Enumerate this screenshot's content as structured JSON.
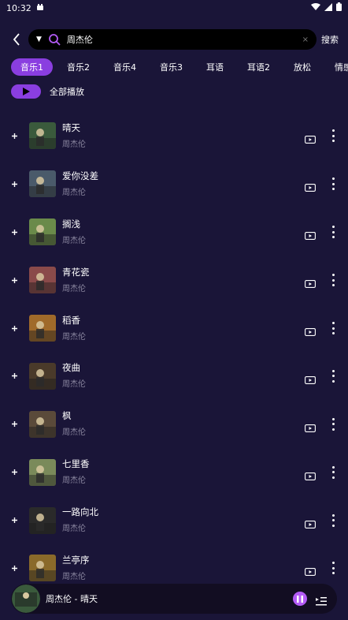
{
  "status_bar": {
    "time": "10:32"
  },
  "header": {
    "search_value": "周杰伦",
    "search_button": "搜索",
    "dropdown_glyph": "▼",
    "clear_glyph": "×"
  },
  "tabs": [
    {
      "label": "音乐1",
      "active": true
    },
    {
      "label": "音乐2",
      "active": false
    },
    {
      "label": "音乐4",
      "active": false
    },
    {
      "label": "音乐3",
      "active": false
    },
    {
      "label": "耳语",
      "active": false
    },
    {
      "label": "耳语2",
      "active": false
    },
    {
      "label": "放松",
      "active": false
    },
    {
      "label": "情感",
      "active": false
    }
  ],
  "play_all": {
    "label": "全部播放"
  },
  "songs": [
    {
      "title": "晴天",
      "artist": "周杰伦",
      "cover": "#3a5a3c"
    },
    {
      "title": "爱你没差",
      "artist": "周杰伦",
      "cover": "#4a5a6a"
    },
    {
      "title": "搁浅",
      "artist": "周杰伦",
      "cover": "#6a8a4a"
    },
    {
      "title": "青花瓷",
      "artist": "周杰伦",
      "cover": "#8a4a4a"
    },
    {
      "title": "稻香",
      "artist": "周杰伦",
      "cover": "#a06a2a"
    },
    {
      "title": "夜曲",
      "artist": "周杰伦",
      "cover": "#4a3a2a"
    },
    {
      "title": "枫",
      "artist": "周杰伦",
      "cover": "#5a4a3a"
    },
    {
      "title": "七里香",
      "artist": "周杰伦",
      "cover": "#7a8a5a"
    },
    {
      "title": "一路向北",
      "artist": "周杰伦",
      "cover": "#2a2a2a"
    },
    {
      "title": "兰亭序",
      "artist": "周杰伦",
      "cover": "#8a6a2a"
    }
  ],
  "mini_player": {
    "now_playing": "周杰伦 - 晴天"
  },
  "colors": {
    "accent": "#8a3ee0",
    "background": "#1a1538",
    "subtext": "#8b87a0"
  }
}
